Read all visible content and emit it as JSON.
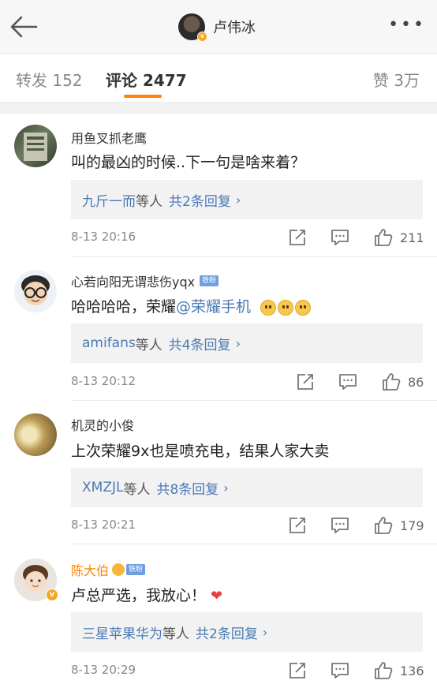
{
  "header": {
    "title": "卢伟冰"
  },
  "tabs": {
    "repost": "转发 152",
    "comments": "评论 2477",
    "likes": "赞 3万"
  },
  "comments": [
    {
      "name": "用鱼叉抓老鹰",
      "text": "叫的最凶的时候..下一句是啥来着？",
      "reply_users": "九斤一而",
      "reply_suffix": "等人",
      "reply_count": "共2条回复",
      "time": "8-13 20:16",
      "likes": "211"
    },
    {
      "name": "心若向阳无谓悲伤yqx",
      "badge": "铁粉",
      "text_prefix": "哈哈哈哈，荣耀",
      "mention": "@荣耀手机",
      "reply_users": "amifans",
      "reply_suffix": "等人",
      "reply_count": "共4条回复",
      "time": "8-13 20:12",
      "likes": "86"
    },
    {
      "name": "机灵的小俊",
      "text": "上次荣耀9x也是喷充电，结果人家大卖",
      "reply_users": "XMZJL",
      "reply_suffix": "等人",
      "reply_count": "共8条回复",
      "time": "8-13 20:21",
      "likes": "179"
    },
    {
      "name": "陈大伯",
      "badge": "铁粉",
      "text": "卢总严选，我放心！",
      "reply_users": "三星苹果华为",
      "reply_suffix": "等人",
      "reply_count": "共2条回复",
      "time": "8-13 20:29",
      "likes": "136"
    }
  ],
  "icons": {
    "back": "back-arrow-icon",
    "more": "more-icon",
    "repost": "repost-icon",
    "comment": "comment-icon",
    "like": "thumbs-up-icon"
  },
  "colors": {
    "accent": "#ff8200",
    "link": "#4a79b5",
    "verified": "#f5a623"
  }
}
